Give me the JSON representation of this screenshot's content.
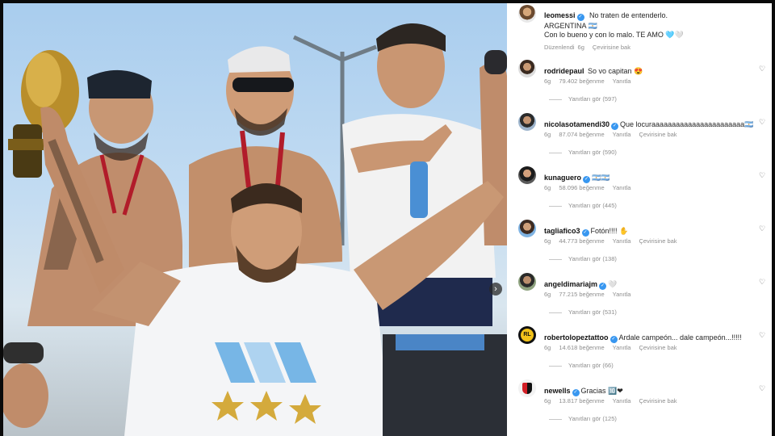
{
  "post": {
    "author": "leomessi",
    "caption_lines": [
      "No traten de entenderlo.",
      "ARGENTINA 🇦🇷",
      "Con lo bueno y con lo malo. TE AMO 🩵🤍"
    ],
    "edited": "Düzenlendi",
    "time": "6g",
    "translate": "Çevirisine bak"
  },
  "photo": {
    "description_icon": "photo-icon",
    "next_icon": "›"
  },
  "comments": [
    {
      "user": "rodridepaul",
      "verified": false,
      "text": "So vo capitan 😍",
      "time": "6g",
      "likes": "79.402 beğenme",
      "reply": "Yanıtla",
      "translate": "",
      "replies": "Yanıtları gör (597)"
    },
    {
      "user": "nicolasotamendi30",
      "verified": true,
      "text": "Que locuraaaaaaaaaaaaaaaaaaaaaaa🇦🇷",
      "time": "6g",
      "likes": "87.074 beğenme",
      "reply": "Yanıtla",
      "translate": "Çevirisine bak",
      "replies": "Yanıtları gör (590)"
    },
    {
      "user": "kunaguero",
      "verified": true,
      "text": "🇦🇷🇦🇷",
      "time": "6g",
      "likes": "58.096 beğenme",
      "reply": "Yanıtla",
      "translate": "",
      "replies": "Yanıtları gör (445)"
    },
    {
      "user": "tagliafico3",
      "verified": true,
      "text": "Fotón!!!! ✋",
      "time": "6g",
      "likes": "44.773 beğenme",
      "reply": "Yanıtla",
      "translate": "Çevirisine bak",
      "replies": "Yanıtları gör (138)"
    },
    {
      "user": "angeldimariajm",
      "verified": true,
      "text": "🤍",
      "time": "6g",
      "likes": "77.215 beğenme",
      "reply": "Yanıtla",
      "translate": "",
      "replies": "Yanıtları gör (531)"
    },
    {
      "user": "robertolopeztattoo",
      "verified": true,
      "text": "Ardale campeón... dale campeón...!!!!!",
      "time": "6g",
      "likes": "14.618 beğenme",
      "reply": "Yanıtla",
      "translate": "Çevirisine bak",
      "replies": "Yanıtları gör (66)"
    },
    {
      "user": "newells",
      "verified": true,
      "text": "Gracias 🔟❤",
      "time": "6g",
      "likes": "13.817 beğenme",
      "reply": "Yanıtla",
      "translate": "Çevirisine bak",
      "replies": "Yanıtları gör (125)"
    }
  ],
  "colors": {
    "verified": "#3897f0",
    "link_grey": "#8e8e8e",
    "heart": "#555555"
  }
}
